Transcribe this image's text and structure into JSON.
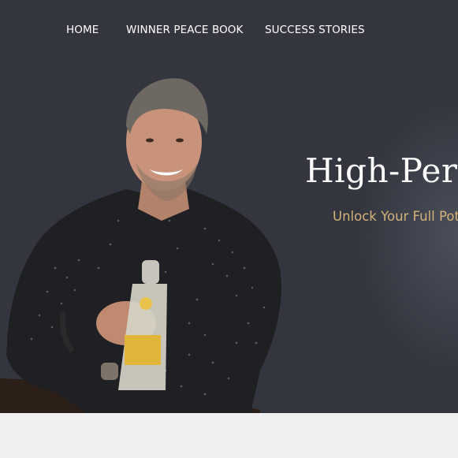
{
  "nav": {
    "items": [
      {
        "label": "HOME"
      },
      {
        "label": "WINNER PEACE BOOK"
      },
      {
        "label": "SUCCESS STORIES"
      }
    ]
  },
  "hero": {
    "title": "High-Perf",
    "subtitle": "Unlock Your Full Pot"
  },
  "colors": {
    "background": "#33363f",
    "accent": "#d4b27a",
    "text": "#ffffff",
    "footer_strip": "#f0f0f0"
  },
  "portrait": {
    "icon": "person-photo"
  }
}
